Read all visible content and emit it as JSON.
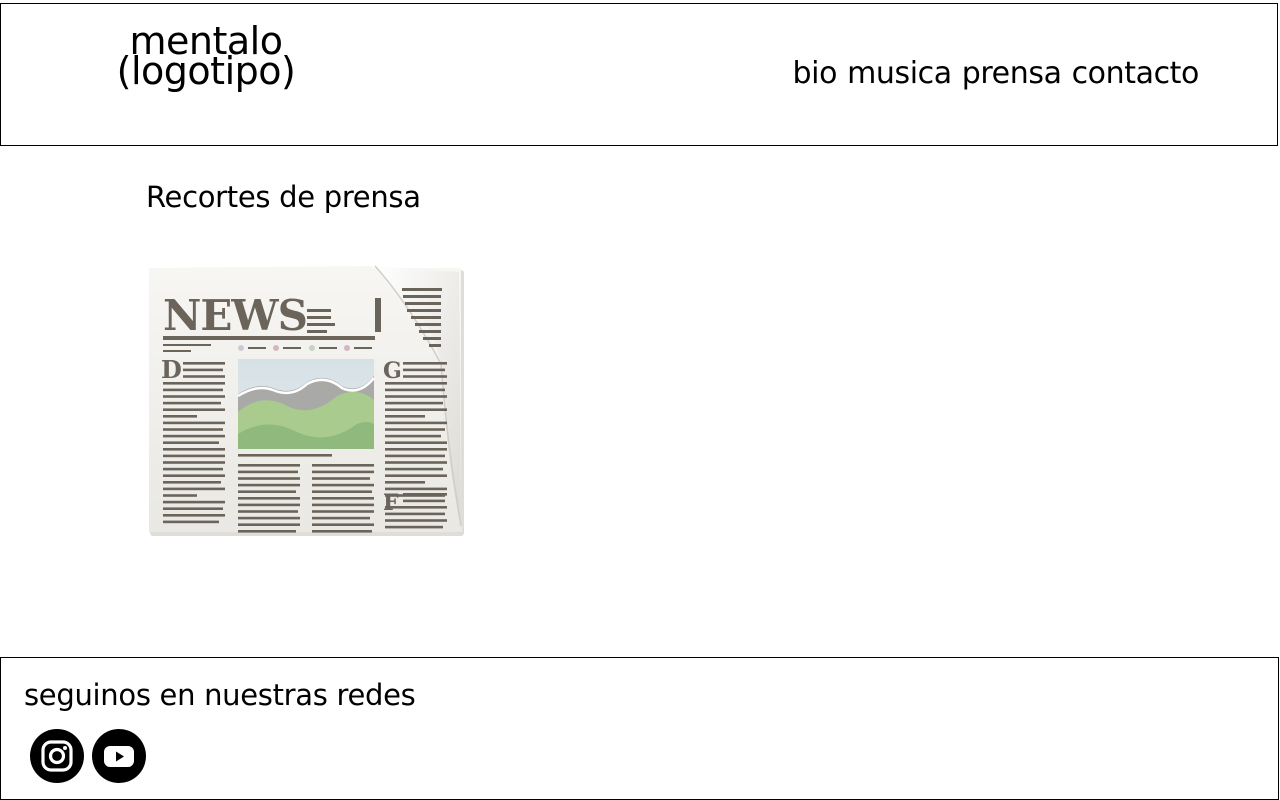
{
  "header": {
    "logo_line1": "mentalo",
    "logo_line2": "(logotipo)",
    "nav": [
      "bio",
      "musica",
      "prensa",
      "contacto"
    ]
  },
  "main": {
    "section_title": "Recortes de prensa",
    "clipping": {
      "headline": "NEWS",
      "initials": [
        "D",
        "G",
        "F"
      ]
    }
  },
  "footer": {
    "title": "seguinos en nuestras redes",
    "social": [
      {
        "icon": "instagram-icon"
      },
      {
        "icon": "youtube-icon"
      }
    ]
  },
  "colors": {
    "text": "#000000",
    "border": "#000000",
    "newsprint_ink": "#6b645a",
    "paper": "#f3f2ee"
  }
}
